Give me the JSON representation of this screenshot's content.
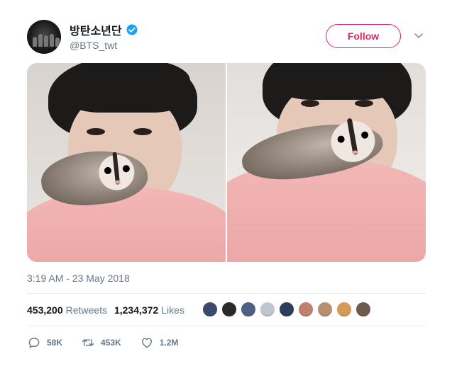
{
  "user": {
    "display_name": "방탄소년단",
    "handle": "@BTS_twt",
    "verified_icon": "verified-badge-icon",
    "avatar_icon": "group-photo-avatar"
  },
  "header": {
    "follow_label": "Follow",
    "menu_icon": "chevron-down-icon"
  },
  "media": {
    "photos": [
      {
        "icon": "photo-man-with-sugar-glider"
      },
      {
        "icon": "photo-man-with-sugar-glider-closeup"
      }
    ]
  },
  "timestamp": "3:19 AM - 23 May 2018",
  "stats": {
    "retweets_count": "453,200",
    "retweets_label": "Retweets",
    "likes_count": "1,234,372",
    "likes_label": "Likes"
  },
  "likers": [
    {
      "color": "#3b4a6b"
    },
    {
      "color": "#2a2a2a"
    },
    {
      "color": "#4f5f84"
    },
    {
      "color": "#bfc6cf"
    },
    {
      "color": "#2f3d5c"
    },
    {
      "color": "#c0826e"
    },
    {
      "color": "#b8906f"
    },
    {
      "color": "#d79a5a"
    },
    {
      "color": "#6f5a4e"
    }
  ],
  "actions": {
    "replies": "58K",
    "retweets": "453K",
    "likes": "1.2M"
  },
  "colors": {
    "accent": "#e0245e",
    "secondary_text": "#657786",
    "verified": "#1da1f2"
  }
}
